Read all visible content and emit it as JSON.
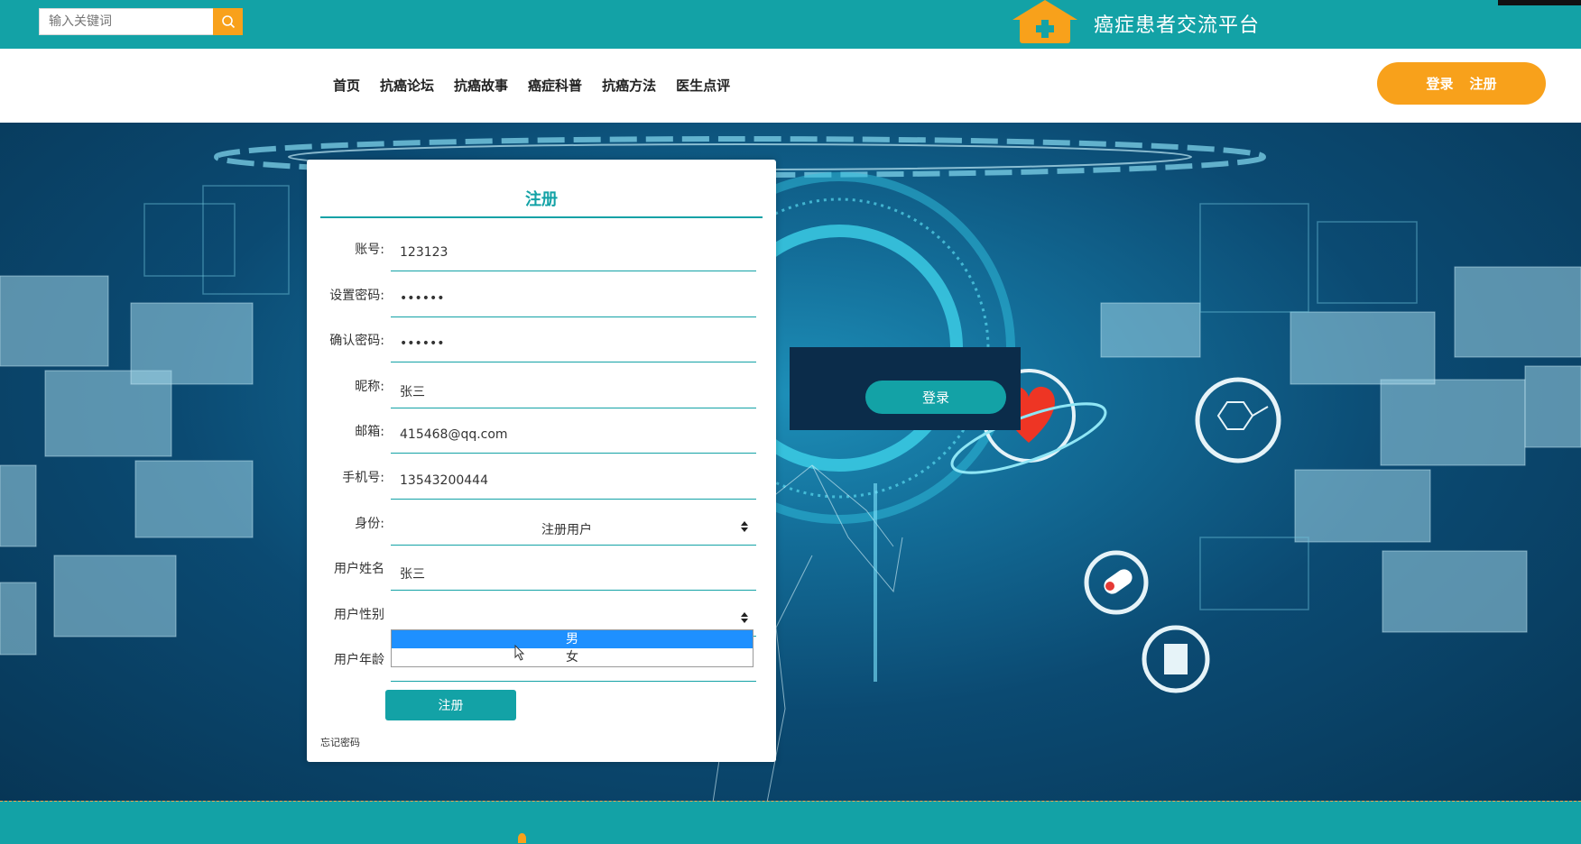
{
  "header": {
    "search_placeholder": "输入关键词",
    "site_title": "癌症患者交流平台"
  },
  "nav": {
    "items": [
      "首页",
      "抗癌论坛",
      "抗癌故事",
      "癌症科普",
      "抗癌方法",
      "医生点评"
    ],
    "login": "登录",
    "register": "注册"
  },
  "form": {
    "title": "注册",
    "fields": [
      {
        "label": "账号:",
        "value": "123123"
      },
      {
        "label": "设置密码:",
        "value": "••••••"
      },
      {
        "label": "确认密码:",
        "value": "••••••"
      },
      {
        "label": "昵称:",
        "placeholder": "张三"
      },
      {
        "label": "邮箱:",
        "value": "415468@qq.com"
      },
      {
        "label": "手机号:",
        "value": "13543200444"
      },
      {
        "label": "身份:",
        "selected": "注册用户"
      },
      {
        "label": "用户姓名",
        "placeholder": "张三"
      },
      {
        "label": "用户性别",
        "selected": ""
      },
      {
        "label": "用户年龄",
        "value": ""
      }
    ],
    "gender_options": [
      "男",
      "女"
    ],
    "highlighted_option": "男",
    "submit": "注册",
    "forgot": "忘记密码"
  },
  "login_panel": {
    "button": "登录"
  },
  "colors": {
    "teal": "#13a2a6",
    "orange": "#f8a11b",
    "highlight": "#1e90ff"
  }
}
